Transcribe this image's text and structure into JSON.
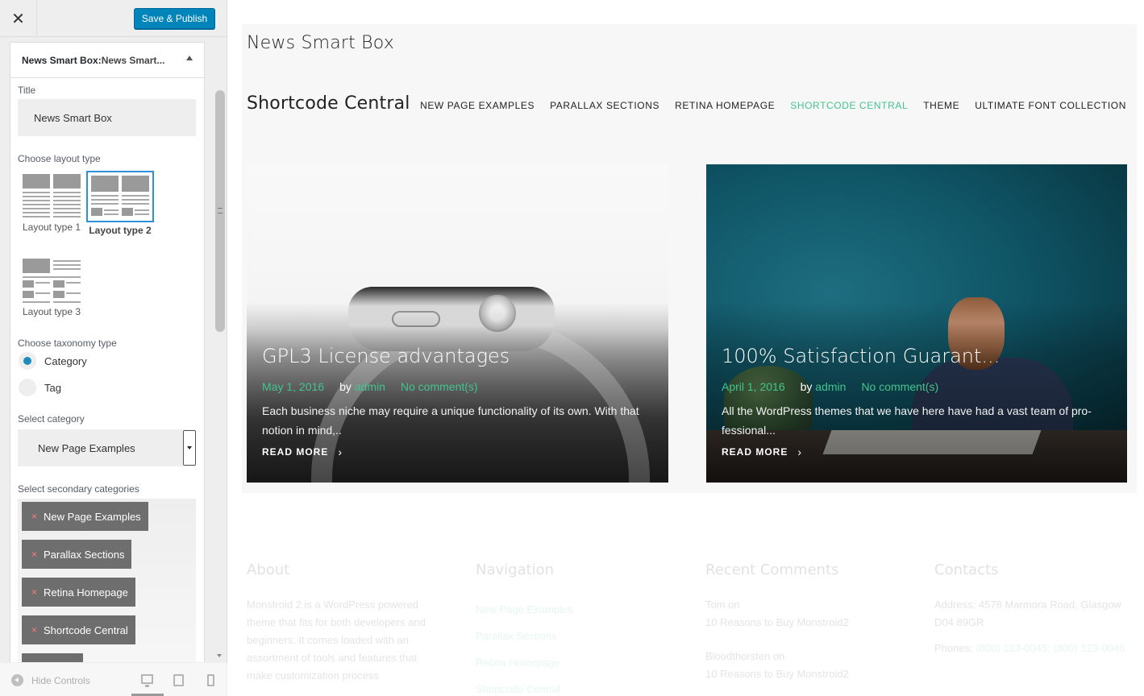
{
  "sidebar": {
    "close_icon": "close-icon",
    "publish_label": "Save & Publish",
    "section": {
      "title_strong": "News Smart Box:",
      "title_rest": " News Smart..."
    },
    "title_label": "Title",
    "title_value": "News Smart Box",
    "layout_label": "Choose layout type",
    "layouts": [
      {
        "label": "Layout type 1",
        "selected": false
      },
      {
        "label": "Layout type 2",
        "selected": true
      },
      {
        "label": "Layout type 3",
        "selected": false
      }
    ],
    "taxonomy_label": "Choose taxonomy type",
    "taxonomy": [
      {
        "label": "Category",
        "checked": true
      },
      {
        "label": "Tag",
        "checked": false
      }
    ],
    "category_label": "Select category",
    "category_value": "New Page Examples",
    "secondary_label": "Select secondary categories",
    "secondary_chips": [
      "New Page Examples",
      "Parallax Sections",
      "Retina Homepage",
      "Shortcode Central"
    ],
    "chip_remove": "×",
    "footer": {
      "hide_controls": "Hide Controls"
    }
  },
  "preview": {
    "widget_title": "News Smart Box",
    "site_title": "Shortcode Central",
    "nav": [
      {
        "label": "NEW PAGE EXAMPLES",
        "active": false
      },
      {
        "label": "PARALLAX SECTIONS",
        "active": false
      },
      {
        "label": "RETINA HOMEPAGE",
        "active": false
      },
      {
        "label": "SHORTCODE CENTRAL",
        "active": true
      },
      {
        "label": "THEME",
        "active": false
      },
      {
        "label": "ULTIMATE FONT COLLECTION",
        "active": false
      }
    ],
    "posts": [
      {
        "title": "GPL3 License advantages",
        "date": "May 1, 2016",
        "by": "by",
        "author": "admin",
        "comments": "No comment(s)",
        "excerpt": "Each business niche may require a unique functionality of its own. With that notion in mind,..",
        "read_more": "READ MORE",
        "chevron": "›"
      },
      {
        "title": "100% Satisfaction Guarant...",
        "date": "April 1, 2016",
        "by": "by",
        "author": "admin",
        "comments": "No comment(s)",
        "excerpt": "All the WordPress themes that we have here have had a vast team of pro-fessional...",
        "read_more": "READ MORE",
        "chevron": "›"
      }
    ],
    "footer": {
      "about": {
        "title": "About",
        "text": "Monstroid 2 is a WordPress powered theme that fits for both developers and beginners. It comes loaded with an assortment of tools and features that make customization process"
      },
      "navigation": {
        "title": "Navigation",
        "links": [
          "New Page Examples",
          "Parallax Sections",
          "Retina Homepage",
          "Shortcode Central"
        ]
      },
      "recent_comments": {
        "title": "Recent Comments",
        "items": [
          "Tom on",
          "10 Reasons to Buy Monstroid2",
          "Bloodthorsten on",
          "10 Reasons to Buy Monstroid2"
        ]
      },
      "contacts": {
        "title": "Contacts",
        "address": "Address: 4578 Marmora Road, Glasgow D04 89GR",
        "phones_label": "Phones:",
        "phones": "(800) 123-0045; (800) 123-0046"
      }
    }
  },
  "colors": {
    "accent_green": "#42c48f",
    "publish_blue": "#0085ba",
    "selected_border": "#2e8fda"
  }
}
